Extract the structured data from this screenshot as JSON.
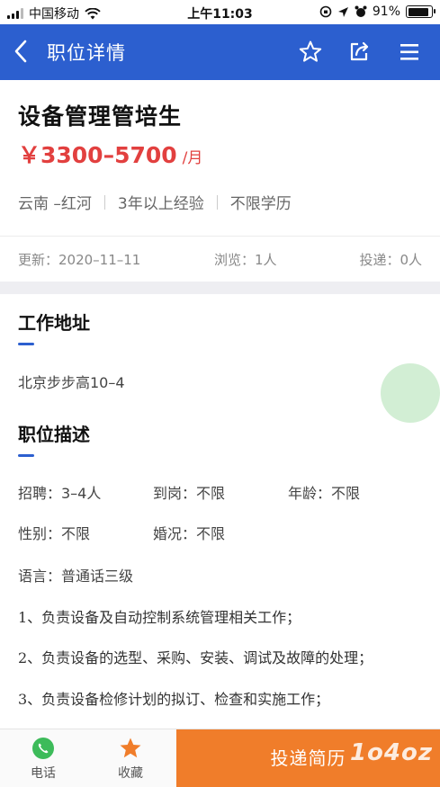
{
  "status_bar": {
    "carrier": "中国移动",
    "time": "上午11:03",
    "battery": "91%",
    "battery_level": 0.91
  },
  "nav": {
    "title": "职位详情",
    "icons": [
      "back-icon",
      "star-icon",
      "share-icon",
      "menu-icon"
    ]
  },
  "job": {
    "title": "设备管理管培生",
    "salary": "￥3300–5700",
    "salary_unit": "/月",
    "location": "云南 –红河",
    "experience": "3年以上经验",
    "education": "不限学历"
  },
  "stats": {
    "updated": "更新：2020–11–11",
    "views": "浏览：1人",
    "applications": "投递：0人"
  },
  "address": {
    "heading": "工作地址",
    "value": "北京步步高10–4"
  },
  "description": {
    "heading": "职位描述",
    "recruit": "招聘：3–4人",
    "arrival": "到岗：不限",
    "age": "年龄：不限",
    "gender": "性别：不限",
    "marriage": "婚况：不限",
    "language": "语言：普通话三级",
    "duties": [
      "1、负责设备及自动控制系统管理相关工作；",
      "2、负责设备的选型、采购、安装、调试及故障的处理；",
      "3、负责设备检修计划的拟订、检查和实施工作；"
    ]
  },
  "bottom_bar": {
    "phone_label": "电话",
    "favorite_label": "收藏",
    "apply_label": "投递简历",
    "watermark": "1o4oz",
    "colors": {
      "apply": "#f07d2a",
      "phone_icon": "#3dbb5a",
      "favorite_icon": "#f07d2a"
    }
  },
  "colors": {
    "nav": "#2c5fcf",
    "salary": "#e2403f",
    "accent": "#2c5fcf"
  }
}
